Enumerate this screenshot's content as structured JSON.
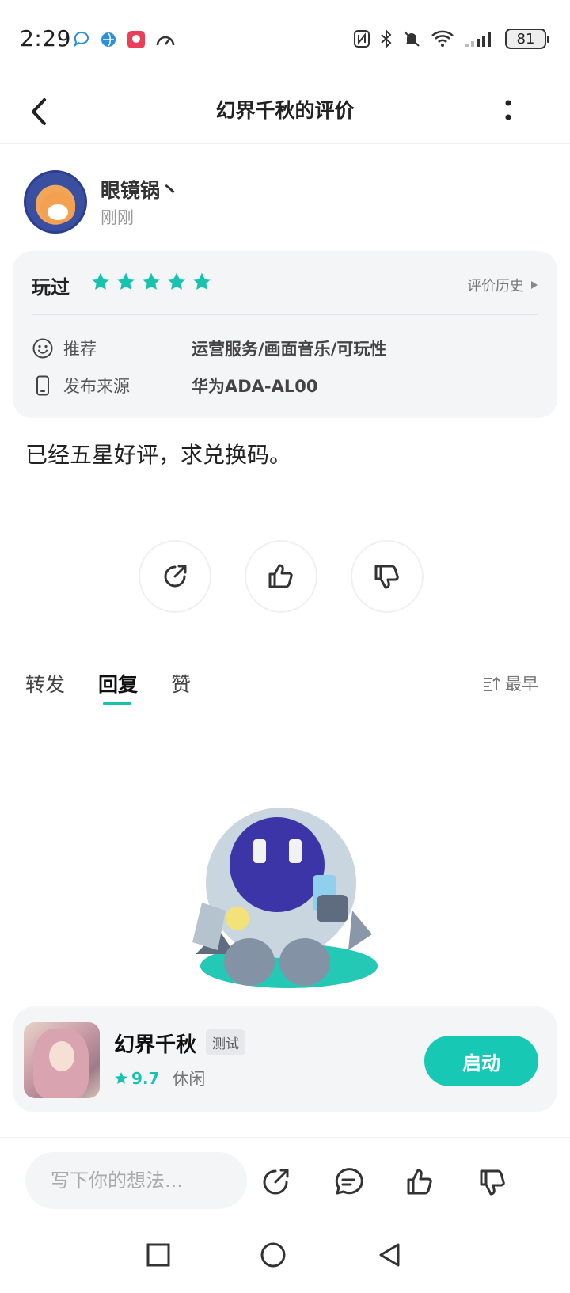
{
  "status_bar": {
    "time": "2:29",
    "battery": "81",
    "app_icons": [
      "chat-bubble-icon",
      "browser-icon",
      "app-badge-icon",
      "speed-icon"
    ],
    "system_icons": [
      "nfc-icon",
      "bluetooth-icon",
      "mute-icon",
      "wifi-icon",
      "signal-icon"
    ]
  },
  "header": {
    "title": "幻界千秋的评价"
  },
  "review": {
    "author_name": "眼镜锅丶",
    "time": "刚刚",
    "played_label": "玩过",
    "rating": 5,
    "rating_max": 5,
    "history_link": "评价历史",
    "recommend_label": "推荐",
    "recommend_value": "运营服务/画面音乐/可玩性",
    "source_label": "发布来源",
    "source_value": "华为ADA-AL00",
    "content": "已经五星好评，求兑换码。"
  },
  "tabs": [
    {
      "label": "转发",
      "active": false
    },
    {
      "label": "回复",
      "active": true
    },
    {
      "label": "赞",
      "active": false
    }
  ],
  "sort_label": "最早",
  "game": {
    "name": "幻界千秋",
    "tag": "测试",
    "score": "9.7",
    "genre": "休闲",
    "launch_label": "启动"
  },
  "bottom_bar": {
    "input_placeholder": "写下你的想法..."
  },
  "colors": {
    "accent": "#17C3AE",
    "card_bg": "#F4F5F7",
    "text_primary": "#222222",
    "text_secondary": "#999999"
  }
}
